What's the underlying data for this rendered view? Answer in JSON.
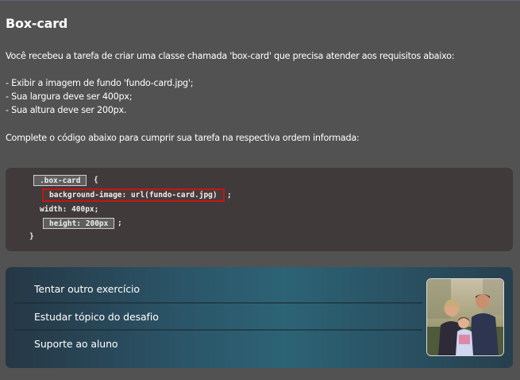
{
  "exercise": {
    "title": "Box-card",
    "intro": "Você recebeu a tarefa de criar uma classe chamada 'box-card' que precisa atender aos requisitos abaixo:",
    "requirements": [
      "- Exibir a imagem de fundo 'fundo-card.jpg';",
      "- Sua largura deve ser 400px;",
      "- Sua altura deve ser 200px."
    ],
    "instruction": "Complete o código abaixo para cumprir sua tarefa na respectiva ordem informada:"
  },
  "code": {
    "selector_slot": ".box-card",
    "open_brace": "{",
    "background_slot": "background-image: url(fundo-card.jpg)",
    "semicolon_1": ";",
    "width_line": "width: 400px;",
    "height_slot": "height: 200px",
    "semicolon_2": ";",
    "close_brace": "}"
  },
  "actions": {
    "items": [
      {
        "label": "Tentar outro exercício"
      },
      {
        "label": "Estudar tópico do desafio"
      },
      {
        "label": "Suporte ao aluno"
      }
    ]
  },
  "colors": {
    "page_background": "#525252",
    "code_background": "#403a3a",
    "error_outline": "#c21616",
    "actions_gradient_mid": "#2c6375"
  }
}
